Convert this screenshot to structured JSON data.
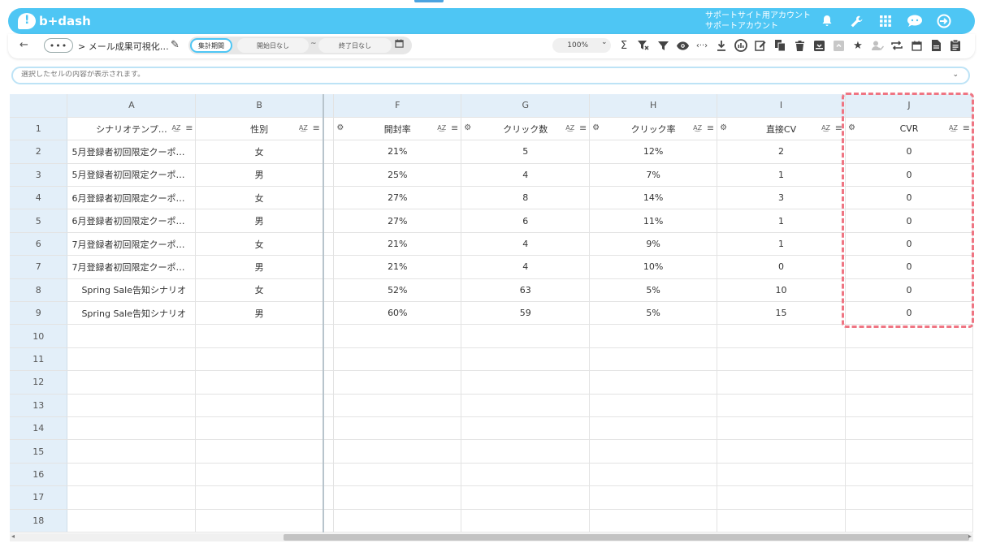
{
  "header": {
    "logo_text": "b+dash",
    "account_line1": "サポートサイト用アカウント",
    "account_line2": "サポートアカウント",
    "icons": [
      "bell-icon",
      "wrench-icon",
      "apps-grid-icon",
      "chat-icon",
      "logout-icon"
    ]
  },
  "toolbar": {
    "back": "←",
    "more": "•••",
    "breadcrumb": "> メール成果可視化…",
    "period_label": "集計期間",
    "start_date": "開始日なし",
    "tilde": "~",
    "end_date": "終了日なし",
    "zoom": "100%",
    "icons": [
      "sum-icon",
      "filter-clear-icon",
      "filter-icon",
      "eye-icon",
      "code-icon",
      "download-icon",
      "chart-icon",
      "edit-icon",
      "copy-icon",
      "trash-icon",
      "archive-icon",
      "archive-disabled-icon",
      "star-icon",
      "user-check-icon",
      "repeat-icon",
      "calendar-icon",
      "document-icon",
      "clipboard-icon"
    ]
  },
  "cellbar": {
    "placeholder": "選択したセルの内容が表示されます。"
  },
  "columns": [
    {
      "letter": "A",
      "header": "シナリオテンプ…"
    },
    {
      "letter": "B",
      "header": "性別"
    },
    {
      "letter": "F",
      "header": "開封率"
    },
    {
      "letter": "G",
      "header": "クリック数"
    },
    {
      "letter": "H",
      "header": "クリック率"
    },
    {
      "letter": "I",
      "header": "直接CV"
    },
    {
      "letter": "J",
      "header": "CVR"
    }
  ],
  "rows": [
    [
      "5月登録者初回限定クーポ…",
      "女",
      "21%",
      "5",
      "12%",
      "2",
      "0"
    ],
    [
      "5月登録者初回限定クーポ…",
      "男",
      "25%",
      "4",
      "7%",
      "1",
      "0"
    ],
    [
      "6月登録者初回限定クーポ…",
      "女",
      "27%",
      "8",
      "14%",
      "3",
      "0"
    ],
    [
      "6月登録者初回限定クーポ…",
      "男",
      "27%",
      "6",
      "11%",
      "1",
      "0"
    ],
    [
      "7月登録者初回限定クーポ…",
      "女",
      "21%",
      "4",
      "9%",
      "1",
      "0"
    ],
    [
      "7月登録者初回限定クーポ…",
      "男",
      "21%",
      "4",
      "10%",
      "0",
      "0"
    ],
    [
      "Spring Sale告知シナリオ",
      "女",
      "52%",
      "63",
      "5%",
      "10",
      "0"
    ],
    [
      "Spring Sale告知シナリオ",
      "男",
      "60%",
      "59",
      "5%",
      "15",
      "0"
    ]
  ],
  "row_numbers": [
    "1",
    "2",
    "3",
    "4",
    "5",
    "6",
    "7",
    "8",
    "9",
    "10",
    "11",
    "12",
    "13",
    "14",
    "15",
    "16",
    "17",
    "18"
  ],
  "sort_glyph": "A͜Z",
  "colors": {
    "brand": "#4ec6f4",
    "header_bg": "#e3eff9",
    "highlight": "#ef7583"
  }
}
